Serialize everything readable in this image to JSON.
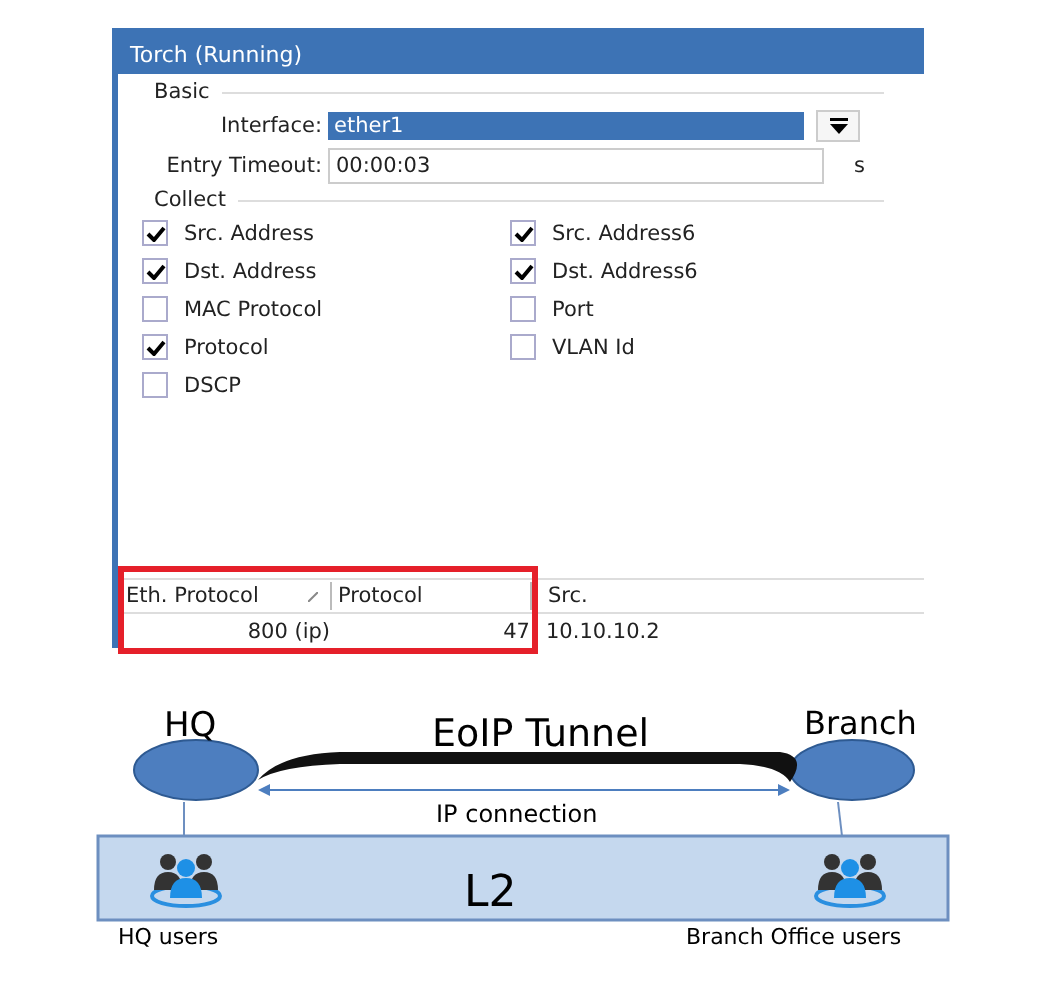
{
  "window": {
    "title": "Torch (Running)"
  },
  "basic": {
    "legend": "Basic",
    "interface": {
      "label": "Interface:",
      "value": "ether1"
    },
    "entry_timeout": {
      "label": "Entry Timeout:",
      "value": "00:00:03",
      "unit": "s"
    }
  },
  "collect": {
    "legend": "Collect",
    "left_column": [
      {
        "label": "Src. Address",
        "checked": true
      },
      {
        "label": "Dst. Address",
        "checked": true
      },
      {
        "label": "MAC Protocol",
        "checked": false
      },
      {
        "label": "Protocol",
        "checked": true
      },
      {
        "label": "DSCP",
        "checked": false
      }
    ],
    "right_column": [
      {
        "label": "Src. Address6",
        "checked": true
      },
      {
        "label": "Dst. Address6",
        "checked": true
      },
      {
        "label": "Port",
        "checked": false
      },
      {
        "label": "VLAN Id",
        "checked": false
      }
    ]
  },
  "table": {
    "columns": [
      "Eth. Protocol",
      "Protocol",
      "Src."
    ],
    "rows": [
      [
        "800 (ip)",
        "47",
        "10.10.10.2"
      ]
    ]
  },
  "diagram": {
    "hq": "HQ",
    "branch": "Branch",
    "tunnel": "EoIP Tunnel",
    "ip_link": "IP connection",
    "network": "L2",
    "hq_users": "HQ users",
    "branch_users": "Branch Office users"
  }
}
